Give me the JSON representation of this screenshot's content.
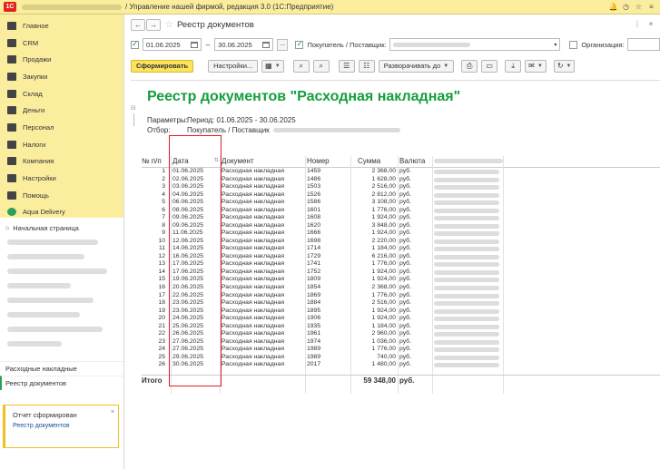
{
  "window": {
    "logo": "1С",
    "title": "/ Управление нашей фирмой, редакция 3.0  (1С:Предприятие)"
  },
  "sidebar": {
    "sections": [
      {
        "label": "Главное",
        "icon": "menu-icon"
      },
      {
        "label": "CRM",
        "icon": "crm-icon"
      },
      {
        "label": "Продажи",
        "icon": "sales-icon"
      },
      {
        "label": "Закупки",
        "icon": "purchases-icon"
      },
      {
        "label": "Склад",
        "icon": "warehouse-icon"
      },
      {
        "label": "Деньги",
        "icon": "money-icon"
      },
      {
        "label": "Персонал",
        "icon": "staff-icon"
      },
      {
        "label": "Налоги",
        "icon": "taxes-icon"
      },
      {
        "label": "Компания",
        "icon": "company-icon"
      },
      {
        "label": "Настройки",
        "icon": "settings-icon"
      },
      {
        "label": "Помощь",
        "icon": "help-icon"
      },
      {
        "label": "Aqua Delivery",
        "icon": "aqua-icon"
      }
    ],
    "home": "Начальная страница",
    "open_windows": [
      "Расходные накладные",
      "Реестр документов"
    ]
  },
  "notification": {
    "title": "Отчет сформирован",
    "link": "Реестр документов",
    "close": "×"
  },
  "header": {
    "back": "←",
    "forward": "→",
    "title": "Реестр документов",
    "icons": [
      "⋮",
      "×"
    ]
  },
  "filters": {
    "date_from": "01.06.2025",
    "date_to": "30.06.2025",
    "dash": "–",
    "dots": "...",
    "counterparty_label": "Покупатель / Поставщик:",
    "organization_label": "Организация:"
  },
  "toolbar": {
    "generate": "Сформировать",
    "settings": "Настройки...",
    "expand": "Разворачивать до"
  },
  "report": {
    "title": "Реестр документов \"Расходная накладная\"",
    "params_label": "Параметры:",
    "params_value": "Период: 01.06.2025 - 30.06.2025",
    "filter_label": "Отбор:",
    "filter_value": "Покупатель / Поставщик",
    "columns": {
      "n": "№ п/п",
      "date": "Дата",
      "doc": "Документ",
      "number": "Номер",
      "sum": "Сумма",
      "currency": "Валюта"
    },
    "rows": [
      {
        "n": "1",
        "date": "01.06.2025",
        "doc": "Расходная накладная",
        "number": "1459",
        "sum": "2 368,00",
        "cur": "руб."
      },
      {
        "n": "2",
        "date": "02.06.2025",
        "doc": "Расходная накладная",
        "number": "1486",
        "sum": "1 628,00",
        "cur": "руб."
      },
      {
        "n": "3",
        "date": "03.06.2025",
        "doc": "Расходная накладная",
        "number": "1503",
        "sum": "2 516,00",
        "cur": "руб."
      },
      {
        "n": "4",
        "date": "04.06.2025",
        "doc": "Расходная накладная",
        "number": "1526",
        "sum": "2 812,00",
        "cur": "руб."
      },
      {
        "n": "5",
        "date": "06.06.2025",
        "doc": "Расходная накладная",
        "number": "1586",
        "sum": "3 108,00",
        "cur": "руб."
      },
      {
        "n": "6",
        "date": "08.06.2025",
        "doc": "Расходная накладная",
        "number": "1601",
        "sum": "1 776,00",
        "cur": "руб."
      },
      {
        "n": "7",
        "date": "09.06.2025",
        "doc": "Расходная накладная",
        "number": "1608",
        "sum": "1 924,00",
        "cur": "руб."
      },
      {
        "n": "8",
        "date": "09.06.2025",
        "doc": "Расходная накладная",
        "number": "1620",
        "sum": "3 848,00",
        "cur": "руб."
      },
      {
        "n": "9",
        "date": "11.06.2025",
        "doc": "Расходная накладная",
        "number": "1666",
        "sum": "1 924,00",
        "cur": "руб."
      },
      {
        "n": "10",
        "date": "12.06.2025",
        "doc": "Расходная накладная",
        "number": "1698",
        "sum": "2 220,00",
        "cur": "руб."
      },
      {
        "n": "11",
        "date": "14.06.2025",
        "doc": "Расходная накладная",
        "number": "1714",
        "sum": "1 184,00",
        "cur": "руб."
      },
      {
        "n": "12",
        "date": "16.06.2025",
        "doc": "Расходная накладная",
        "number": "1729",
        "sum": "6 216,00",
        "cur": "руб."
      },
      {
        "n": "13",
        "date": "17.06.2025",
        "doc": "Расходная накладная",
        "number": "1741",
        "sum": "1 776,00",
        "cur": "руб."
      },
      {
        "n": "14",
        "date": "17.06.2025",
        "doc": "Расходная накладная",
        "number": "1752",
        "sum": "1 924,00",
        "cur": "руб."
      },
      {
        "n": "15",
        "date": "19.06.2025",
        "doc": "Расходная накладная",
        "number": "1809",
        "sum": "1 924,00",
        "cur": "руб."
      },
      {
        "n": "16",
        "date": "20.06.2025",
        "doc": "Расходная накладная",
        "number": "1854",
        "sum": "2 368,00",
        "cur": "руб."
      },
      {
        "n": "17",
        "date": "22.06.2025",
        "doc": "Расходная накладная",
        "number": "1869",
        "sum": "1 776,00",
        "cur": "руб."
      },
      {
        "n": "18",
        "date": "23.06.2025",
        "doc": "Расходная накладная",
        "number": "1884",
        "sum": "2 516,00",
        "cur": "руб."
      },
      {
        "n": "19",
        "date": "23.06.2025",
        "doc": "Расходная накладная",
        "number": "1895",
        "sum": "1 924,00",
        "cur": "руб."
      },
      {
        "n": "20",
        "date": "24.06.2025",
        "doc": "Расходная накладная",
        "number": "1906",
        "sum": "1 924,00",
        "cur": "руб."
      },
      {
        "n": "21",
        "date": "25.06.2025",
        "doc": "Расходная накладная",
        "number": "1935",
        "sum": "1 184,00",
        "cur": "руб."
      },
      {
        "n": "22",
        "date": "26.06.2025",
        "doc": "Расходная накладная",
        "number": "1961",
        "sum": "2 960,00",
        "cur": "руб."
      },
      {
        "n": "23",
        "date": "27.06.2025",
        "doc": "Расходная накладная",
        "number": "1974",
        "sum": "1 036,00",
        "cur": "руб."
      },
      {
        "n": "24",
        "date": "27.06.2025",
        "doc": "Расходная накладная",
        "number": "1989",
        "sum": "1 776,00",
        "cur": "руб."
      },
      {
        "n": "25",
        "date": "29.06.2025",
        "doc": "Расходная накладная",
        "number": "1989",
        "sum": "740,00",
        "cur": "руб."
      },
      {
        "n": "26",
        "date": "30.06.2025",
        "doc": "Расходная накладная",
        "number": "2017",
        "sum": "1 480,00",
        "cur": "руб."
      }
    ],
    "total_label": "Итого",
    "total_sum": "59 348,00",
    "total_cur": "руб."
  }
}
